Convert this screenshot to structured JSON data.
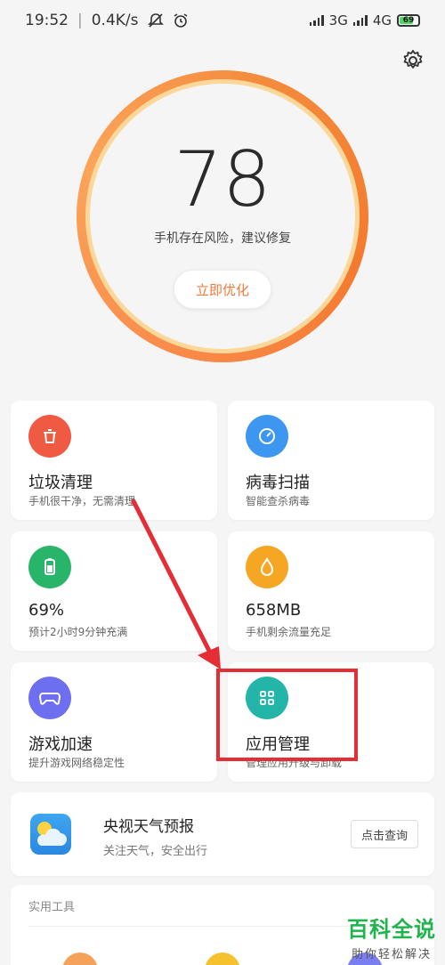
{
  "status_bar": {
    "time": "19:52",
    "speed": "0.4K/s",
    "net1": "3G",
    "net2": "4G",
    "battery": "69"
  },
  "score": {
    "value": "78",
    "message": "手机存在风险，建议修复",
    "button": "立即优化"
  },
  "tiles": [
    {
      "title": "垃圾清理",
      "subtitle": "手机很干净，无需清理",
      "color": "#f05a42",
      "icon": "trash-icon"
    },
    {
      "title": "病毒扫描",
      "subtitle": "智能查杀病毒",
      "color": "#3d96f0",
      "icon": "gauge-icon"
    },
    {
      "title": "69%",
      "subtitle": "预计2小时9分钟充满",
      "color": "#29b569",
      "icon": "battery-icon"
    },
    {
      "title": "658MB",
      "subtitle": "手机剩余流量充足",
      "color": "#f5a623",
      "icon": "drop-icon"
    },
    {
      "title": "游戏加速",
      "subtitle": "提升游戏网络稳定性",
      "color": "#6e6ef0",
      "icon": "gamepad-icon"
    },
    {
      "title": "应用管理",
      "subtitle": "管理应用升级与卸载",
      "color": "#23b5a8",
      "icon": "grid-icon"
    }
  ],
  "weather": {
    "title": "央视天气预报",
    "subtitle": "关注天气，安全出行",
    "button": "点击查询"
  },
  "tools": {
    "title": "实用工具"
  },
  "watermark": {
    "line1": "百科全说",
    "line2": "助你轻松解决"
  },
  "colors": {
    "accent": "#f07a3a",
    "annotation": "#e52d35"
  }
}
